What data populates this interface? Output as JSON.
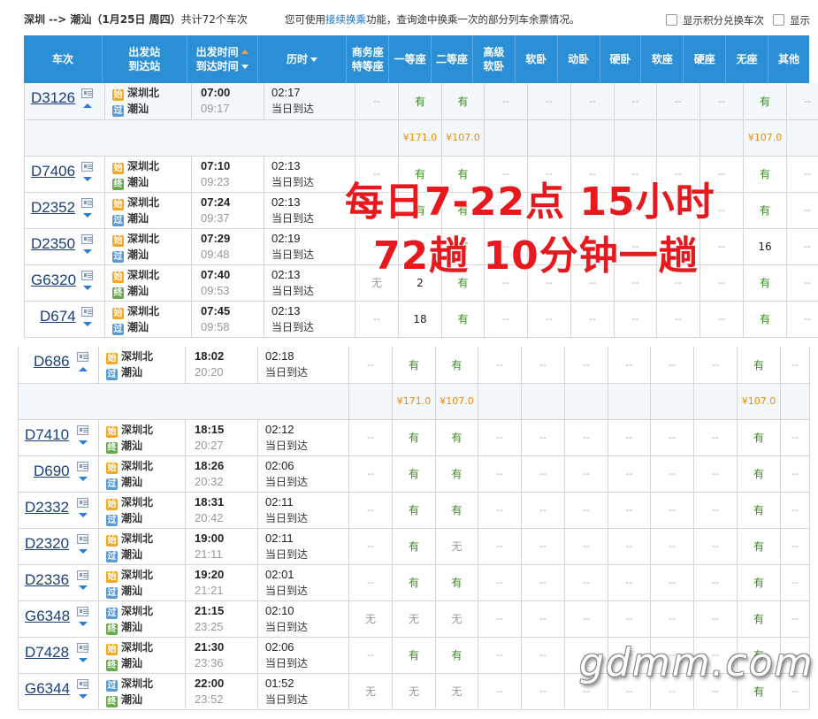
{
  "top": {
    "route": "深圳 --> 潮汕（1月25日  周四）",
    "count": "共计72个车次",
    "hint_pre": "您可使用",
    "hint_link": "接续换乘",
    "hint_post": "功能，查询途中换乘一次的部分列车余票情况。",
    "check1": "显示积分兑换车次",
    "check2": "显示"
  },
  "header": {
    "train": "车次",
    "station1": "出发站",
    "station2": "到达站",
    "time1": "出发时间",
    "time2": "到达时间",
    "duration": "历时",
    "biz1": "商务座",
    "biz2": "特等座",
    "first": "一等座",
    "second": "二等座",
    "hsoft1": "高级",
    "hsoft2": "软卧",
    "soft": "软卧",
    "dong": "动卧",
    "hard": "硬卧",
    "softseat": "软座",
    "hardseat": "硬座",
    "noseat": "无座",
    "other": "其他"
  },
  "badges": {
    "start": "始",
    "pass": "过",
    "end": "终"
  },
  "table1": [
    {
      "type": "train",
      "num": "D3126",
      "arrow": "up",
      "b1": "start",
      "s1": "深圳北",
      "b2": "pass",
      "s2": "潮汕",
      "dep": "07:00",
      "arr": "09:17",
      "dur": "02:17",
      "day": "当日到达",
      "seats": [
        "--",
        "有",
        "有",
        "--",
        "--",
        "--",
        "--",
        "--",
        "--",
        "有",
        "--"
      ]
    },
    {
      "type": "price",
      "seats": [
        "",
        "¥171.0",
        "¥107.0",
        "",
        "",
        "",
        "",
        "",
        "",
        "¥107.0",
        ""
      ]
    },
    {
      "type": "train",
      "num": "D7406",
      "arrow": "down",
      "b1": "start",
      "s1": "深圳北",
      "b2": "end",
      "s2": "潮汕",
      "dep": "07:10",
      "arr": "09:23",
      "dur": "02:13",
      "day": "当日到达",
      "seats": [
        "--",
        "有",
        "有",
        "--",
        "--",
        "--",
        "--",
        "--",
        "--",
        "有",
        "--"
      ]
    },
    {
      "type": "train",
      "num": "D2352",
      "arrow": "down",
      "b1": "start",
      "s1": "深圳北",
      "b2": "pass",
      "s2": "潮汕",
      "dep": "07:24",
      "arr": "09:37",
      "dur": "02:13",
      "day": "当日到达",
      "seats": [
        "--",
        "有",
        "有",
        "--",
        "--",
        "--",
        "--",
        "--",
        "--",
        "有",
        "--"
      ]
    },
    {
      "type": "train",
      "num": "D2350",
      "arrow": "down",
      "b1": "start",
      "s1": "深圳北",
      "b2": "pass",
      "s2": "潮汕",
      "dep": "07:29",
      "arr": "09:48",
      "dur": "02:19",
      "day": "当日到达",
      "seats": [
        "--",
        "有",
        "有",
        "--",
        "--",
        "--",
        "--",
        "--",
        "--",
        "16",
        "--"
      ]
    },
    {
      "type": "train",
      "num": "G6320",
      "arrow": "down",
      "b1": "start",
      "s1": "深圳北",
      "b2": "end",
      "s2": "潮汕",
      "dep": "07:40",
      "arr": "09:53",
      "dur": "02:13",
      "day": "当日到达",
      "seats": [
        "无",
        "2",
        "有",
        "--",
        "--",
        "--",
        "--",
        "--",
        "--",
        "有",
        "--"
      ]
    },
    {
      "type": "train",
      "num": "D674",
      "arrow": "down",
      "b1": "start",
      "s1": "深圳北",
      "b2": "pass",
      "s2": "潮汕",
      "dep": "07:45",
      "arr": "09:58",
      "dur": "02:13",
      "day": "当日到达",
      "seats": [
        "--",
        "18",
        "有",
        "--",
        "--",
        "--",
        "--",
        "--",
        "--",
        "有",
        "--"
      ]
    }
  ],
  "table2": [
    {
      "type": "train",
      "num": "D686",
      "arrow": "up",
      "b1": "start",
      "s1": "深圳北",
      "b2": "pass",
      "s2": "潮汕",
      "dep": "18:02",
      "arr": "20:20",
      "dur": "02:18",
      "day": "当日到达",
      "seats": [
        "--",
        "有",
        "有",
        "--",
        "--",
        "--",
        "--",
        "--",
        "--",
        "有",
        "--"
      ]
    },
    {
      "type": "price",
      "seats": [
        "",
        "¥171.0",
        "¥107.0",
        "",
        "",
        "",
        "",
        "",
        "",
        "¥107.0",
        ""
      ]
    },
    {
      "type": "train",
      "num": "D7410",
      "arrow": "down",
      "b1": "start",
      "s1": "深圳北",
      "b2": "end",
      "s2": "潮汕",
      "dep": "18:15",
      "arr": "20:27",
      "dur": "02:12",
      "day": "当日到达",
      "seats": [
        "--",
        "有",
        "有",
        "--",
        "--",
        "--",
        "--",
        "--",
        "--",
        "有",
        "--"
      ]
    },
    {
      "type": "train",
      "num": "D690",
      "arrow": "down",
      "b1": "start",
      "s1": "深圳北",
      "b2": "pass",
      "s2": "潮汕",
      "dep": "18:26",
      "arr": "20:32",
      "dur": "02:06",
      "day": "当日到达",
      "seats": [
        "--",
        "有",
        "有",
        "--",
        "--",
        "--",
        "--",
        "--",
        "--",
        "有",
        "--"
      ]
    },
    {
      "type": "train",
      "num": "D2332",
      "arrow": "down",
      "b1": "start",
      "s1": "深圳北",
      "b2": "pass",
      "s2": "潮汕",
      "dep": "18:31",
      "arr": "20:42",
      "dur": "02:11",
      "day": "当日到达",
      "seats": [
        "--",
        "有",
        "有",
        "--",
        "--",
        "--",
        "--",
        "--",
        "--",
        "有",
        "--"
      ]
    },
    {
      "type": "train",
      "num": "D2320",
      "arrow": "down",
      "b1": "start",
      "s1": "深圳北",
      "b2": "pass",
      "s2": "潮汕",
      "dep": "19:00",
      "arr": "21:11",
      "dur": "02:11",
      "day": "当日到达",
      "seats": [
        "--",
        "有",
        "无",
        "--",
        "--",
        "--",
        "--",
        "--",
        "--",
        "有",
        "--"
      ]
    },
    {
      "type": "train",
      "num": "D2336",
      "arrow": "down",
      "b1": "start",
      "s1": "深圳北",
      "b2": "pass",
      "s2": "潮汕",
      "dep": "19:20",
      "arr": "21:21",
      "dur": "02:01",
      "day": "当日到达",
      "seats": [
        "--",
        "有",
        "有",
        "--",
        "--",
        "--",
        "--",
        "--",
        "--",
        "有",
        "--"
      ]
    },
    {
      "type": "train",
      "num": "G6348",
      "arrow": "down",
      "b1": "pass",
      "s1": "深圳北",
      "b2": "end",
      "s2": "潮汕",
      "dep": "21:15",
      "arr": "23:25",
      "dur": "02:10",
      "day": "当日到达",
      "seats": [
        "无",
        "无",
        "无",
        "--",
        "--",
        "--",
        "--",
        "--",
        "--",
        "有",
        "--"
      ]
    },
    {
      "type": "train",
      "num": "D7428",
      "arrow": "down",
      "b1": "start",
      "s1": "深圳北",
      "b2": "end",
      "s2": "潮汕",
      "dep": "21:30",
      "arr": "23:36",
      "dur": "02:06",
      "day": "当日到达",
      "seats": [
        "--",
        "有",
        "有",
        "--",
        "--",
        "--",
        "--",
        "--",
        "--",
        "有",
        "--"
      ]
    },
    {
      "type": "train",
      "num": "G6344",
      "arrow": "down",
      "b1": "pass",
      "s1": "深圳北",
      "b2": "end",
      "s2": "潮汕",
      "dep": "22:00",
      "arr": "23:52",
      "dur": "01:52",
      "day": "当日到达",
      "seats": [
        "无",
        "无",
        "无",
        "--",
        "--",
        "--",
        "--",
        "--",
        "--",
        "有",
        "--"
      ]
    }
  ],
  "overlay": {
    "line1": "每日7-22点  15小时",
    "line2": "72趟  10分钟一趟"
  },
  "watermark": "gdmm.com"
}
